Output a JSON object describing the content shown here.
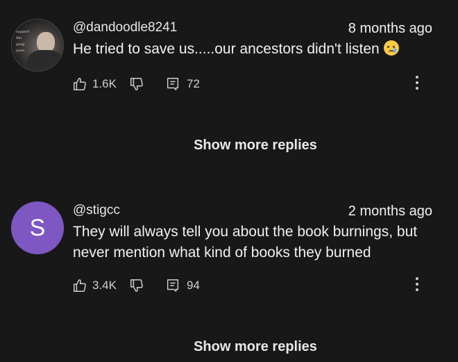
{
  "comments": [
    {
      "author": "@dandoodle8241",
      "timestamp": "8 months ago",
      "text": "He tried to save us.....our ancestors didn't listen",
      "emoji": "crying-face",
      "avatar_type": "photo",
      "avatar_sign_text": "support the yung jawn",
      "likes": "1.6K",
      "replies": "72",
      "show_more": "Show more replies"
    },
    {
      "author": "@stigcc",
      "timestamp": "2 months ago",
      "text": "They will always tell you about the book burnings, but never mention what kind of books they burned",
      "avatar_type": "letter",
      "avatar_letter": "S",
      "avatar_color": "#7e57c2",
      "likes": "3.4K",
      "replies": "94",
      "show_more": "Show more replies"
    }
  ]
}
